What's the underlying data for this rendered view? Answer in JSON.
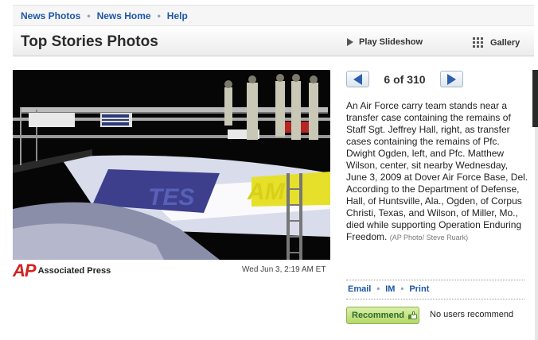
{
  "topnav": {
    "links": [
      "News Photos",
      "News Home",
      "Help"
    ],
    "separator": "•"
  },
  "header": {
    "title": "Top Stories Photos",
    "play_slideshow": "Play Slideshow",
    "gallery": "Gallery"
  },
  "pager": {
    "counter": "6 of 310"
  },
  "caption": {
    "text": "An Air Force carry team stands near a transfer case containing the remains of Staff Sgt. Jeffrey Hall, right, as transfer cases containing the remains of Pfc. Dwight Ogden, left, and Pfc. Matthew Wilson, center, sit nearby Wednesday, June 3, 2009 at Dover Air Force Base, Del. According to the Department of Defense, Hall, of Huntsville, Ala., Ogden, of Corpus Christi, Texas, and Wilson, of Miller, Mo., died while supporting Operation Enduring Freedom.",
    "credit": "(AP Photo/ Steve Ruark)"
  },
  "photo_meta": {
    "source_mark": "AP",
    "source_name": "Associated Press",
    "timestamp": "Wed Jun 3, 2:19 AM ET"
  },
  "actions": {
    "email": "Email",
    "im": "IM",
    "print": "Print"
  },
  "recommend": {
    "button": "Recommend",
    "status": "No users recommend"
  },
  "colors": {
    "link": "#1d57a8",
    "ap_red": "#d2231e",
    "recommend_green": "#b5d86a"
  }
}
